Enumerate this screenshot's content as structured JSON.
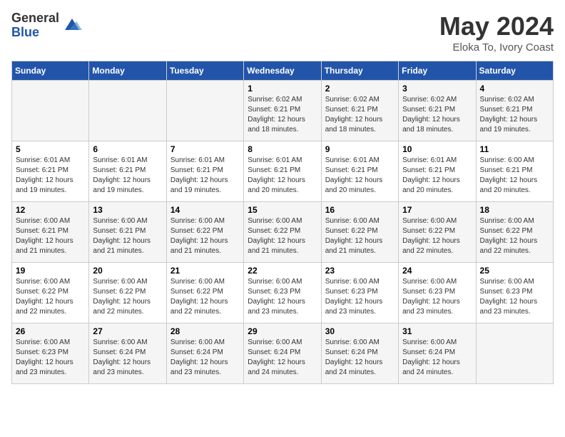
{
  "logo": {
    "general": "General",
    "blue": "Blue"
  },
  "title": {
    "month": "May 2024",
    "location": "Eloka To, Ivory Coast"
  },
  "headers": [
    "Sunday",
    "Monday",
    "Tuesday",
    "Wednesday",
    "Thursday",
    "Friday",
    "Saturday"
  ],
  "weeks": [
    [
      {
        "day": "",
        "sunrise": "",
        "sunset": "",
        "daylight": ""
      },
      {
        "day": "",
        "sunrise": "",
        "sunset": "",
        "daylight": ""
      },
      {
        "day": "",
        "sunrise": "",
        "sunset": "",
        "daylight": ""
      },
      {
        "day": "1",
        "sunrise": "Sunrise: 6:02 AM",
        "sunset": "Sunset: 6:21 PM",
        "daylight": "Daylight: 12 hours and 18 minutes."
      },
      {
        "day": "2",
        "sunrise": "Sunrise: 6:02 AM",
        "sunset": "Sunset: 6:21 PM",
        "daylight": "Daylight: 12 hours and 18 minutes."
      },
      {
        "day": "3",
        "sunrise": "Sunrise: 6:02 AM",
        "sunset": "Sunset: 6:21 PM",
        "daylight": "Daylight: 12 hours and 18 minutes."
      },
      {
        "day": "4",
        "sunrise": "Sunrise: 6:02 AM",
        "sunset": "Sunset: 6:21 PM",
        "daylight": "Daylight: 12 hours and 19 minutes."
      }
    ],
    [
      {
        "day": "5",
        "sunrise": "Sunrise: 6:01 AM",
        "sunset": "Sunset: 6:21 PM",
        "daylight": "Daylight: 12 hours and 19 minutes."
      },
      {
        "day": "6",
        "sunrise": "Sunrise: 6:01 AM",
        "sunset": "Sunset: 6:21 PM",
        "daylight": "Daylight: 12 hours and 19 minutes."
      },
      {
        "day": "7",
        "sunrise": "Sunrise: 6:01 AM",
        "sunset": "Sunset: 6:21 PM",
        "daylight": "Daylight: 12 hours and 19 minutes."
      },
      {
        "day": "8",
        "sunrise": "Sunrise: 6:01 AM",
        "sunset": "Sunset: 6:21 PM",
        "daylight": "Daylight: 12 hours and 20 minutes."
      },
      {
        "day": "9",
        "sunrise": "Sunrise: 6:01 AM",
        "sunset": "Sunset: 6:21 PM",
        "daylight": "Daylight: 12 hours and 20 minutes."
      },
      {
        "day": "10",
        "sunrise": "Sunrise: 6:01 AM",
        "sunset": "Sunset: 6:21 PM",
        "daylight": "Daylight: 12 hours and 20 minutes."
      },
      {
        "day": "11",
        "sunrise": "Sunrise: 6:00 AM",
        "sunset": "Sunset: 6:21 PM",
        "daylight": "Daylight: 12 hours and 20 minutes."
      }
    ],
    [
      {
        "day": "12",
        "sunrise": "Sunrise: 6:00 AM",
        "sunset": "Sunset: 6:21 PM",
        "daylight": "Daylight: 12 hours and 21 minutes."
      },
      {
        "day": "13",
        "sunrise": "Sunrise: 6:00 AM",
        "sunset": "Sunset: 6:21 PM",
        "daylight": "Daylight: 12 hours and 21 minutes."
      },
      {
        "day": "14",
        "sunrise": "Sunrise: 6:00 AM",
        "sunset": "Sunset: 6:22 PM",
        "daylight": "Daylight: 12 hours and 21 minutes."
      },
      {
        "day": "15",
        "sunrise": "Sunrise: 6:00 AM",
        "sunset": "Sunset: 6:22 PM",
        "daylight": "Daylight: 12 hours and 21 minutes."
      },
      {
        "day": "16",
        "sunrise": "Sunrise: 6:00 AM",
        "sunset": "Sunset: 6:22 PM",
        "daylight": "Daylight: 12 hours and 21 minutes."
      },
      {
        "day": "17",
        "sunrise": "Sunrise: 6:00 AM",
        "sunset": "Sunset: 6:22 PM",
        "daylight": "Daylight: 12 hours and 22 minutes."
      },
      {
        "day": "18",
        "sunrise": "Sunrise: 6:00 AM",
        "sunset": "Sunset: 6:22 PM",
        "daylight": "Daylight: 12 hours and 22 minutes."
      }
    ],
    [
      {
        "day": "19",
        "sunrise": "Sunrise: 6:00 AM",
        "sunset": "Sunset: 6:22 PM",
        "daylight": "Daylight: 12 hours and 22 minutes."
      },
      {
        "day": "20",
        "sunrise": "Sunrise: 6:00 AM",
        "sunset": "Sunset: 6:22 PM",
        "daylight": "Daylight: 12 hours and 22 minutes."
      },
      {
        "day": "21",
        "sunrise": "Sunrise: 6:00 AM",
        "sunset": "Sunset: 6:22 PM",
        "daylight": "Daylight: 12 hours and 22 minutes."
      },
      {
        "day": "22",
        "sunrise": "Sunrise: 6:00 AM",
        "sunset": "Sunset: 6:23 PM",
        "daylight": "Daylight: 12 hours and 23 minutes."
      },
      {
        "day": "23",
        "sunrise": "Sunrise: 6:00 AM",
        "sunset": "Sunset: 6:23 PM",
        "daylight": "Daylight: 12 hours and 23 minutes."
      },
      {
        "day": "24",
        "sunrise": "Sunrise: 6:00 AM",
        "sunset": "Sunset: 6:23 PM",
        "daylight": "Daylight: 12 hours and 23 minutes."
      },
      {
        "day": "25",
        "sunrise": "Sunrise: 6:00 AM",
        "sunset": "Sunset: 6:23 PM",
        "daylight": "Daylight: 12 hours and 23 minutes."
      }
    ],
    [
      {
        "day": "26",
        "sunrise": "Sunrise: 6:00 AM",
        "sunset": "Sunset: 6:23 PM",
        "daylight": "Daylight: 12 hours and 23 minutes."
      },
      {
        "day": "27",
        "sunrise": "Sunrise: 6:00 AM",
        "sunset": "Sunset: 6:24 PM",
        "daylight": "Daylight: 12 hours and 23 minutes."
      },
      {
        "day": "28",
        "sunrise": "Sunrise: 6:00 AM",
        "sunset": "Sunset: 6:24 PM",
        "daylight": "Daylight: 12 hours and 23 minutes."
      },
      {
        "day": "29",
        "sunrise": "Sunrise: 6:00 AM",
        "sunset": "Sunset: 6:24 PM",
        "daylight": "Daylight: 12 hours and 24 minutes."
      },
      {
        "day": "30",
        "sunrise": "Sunrise: 6:00 AM",
        "sunset": "Sunset: 6:24 PM",
        "daylight": "Daylight: 12 hours and 24 minutes."
      },
      {
        "day": "31",
        "sunrise": "Sunrise: 6:00 AM",
        "sunset": "Sunset: 6:24 PM",
        "daylight": "Daylight: 12 hours and 24 minutes."
      },
      {
        "day": "",
        "sunrise": "",
        "sunset": "",
        "daylight": ""
      }
    ]
  ]
}
